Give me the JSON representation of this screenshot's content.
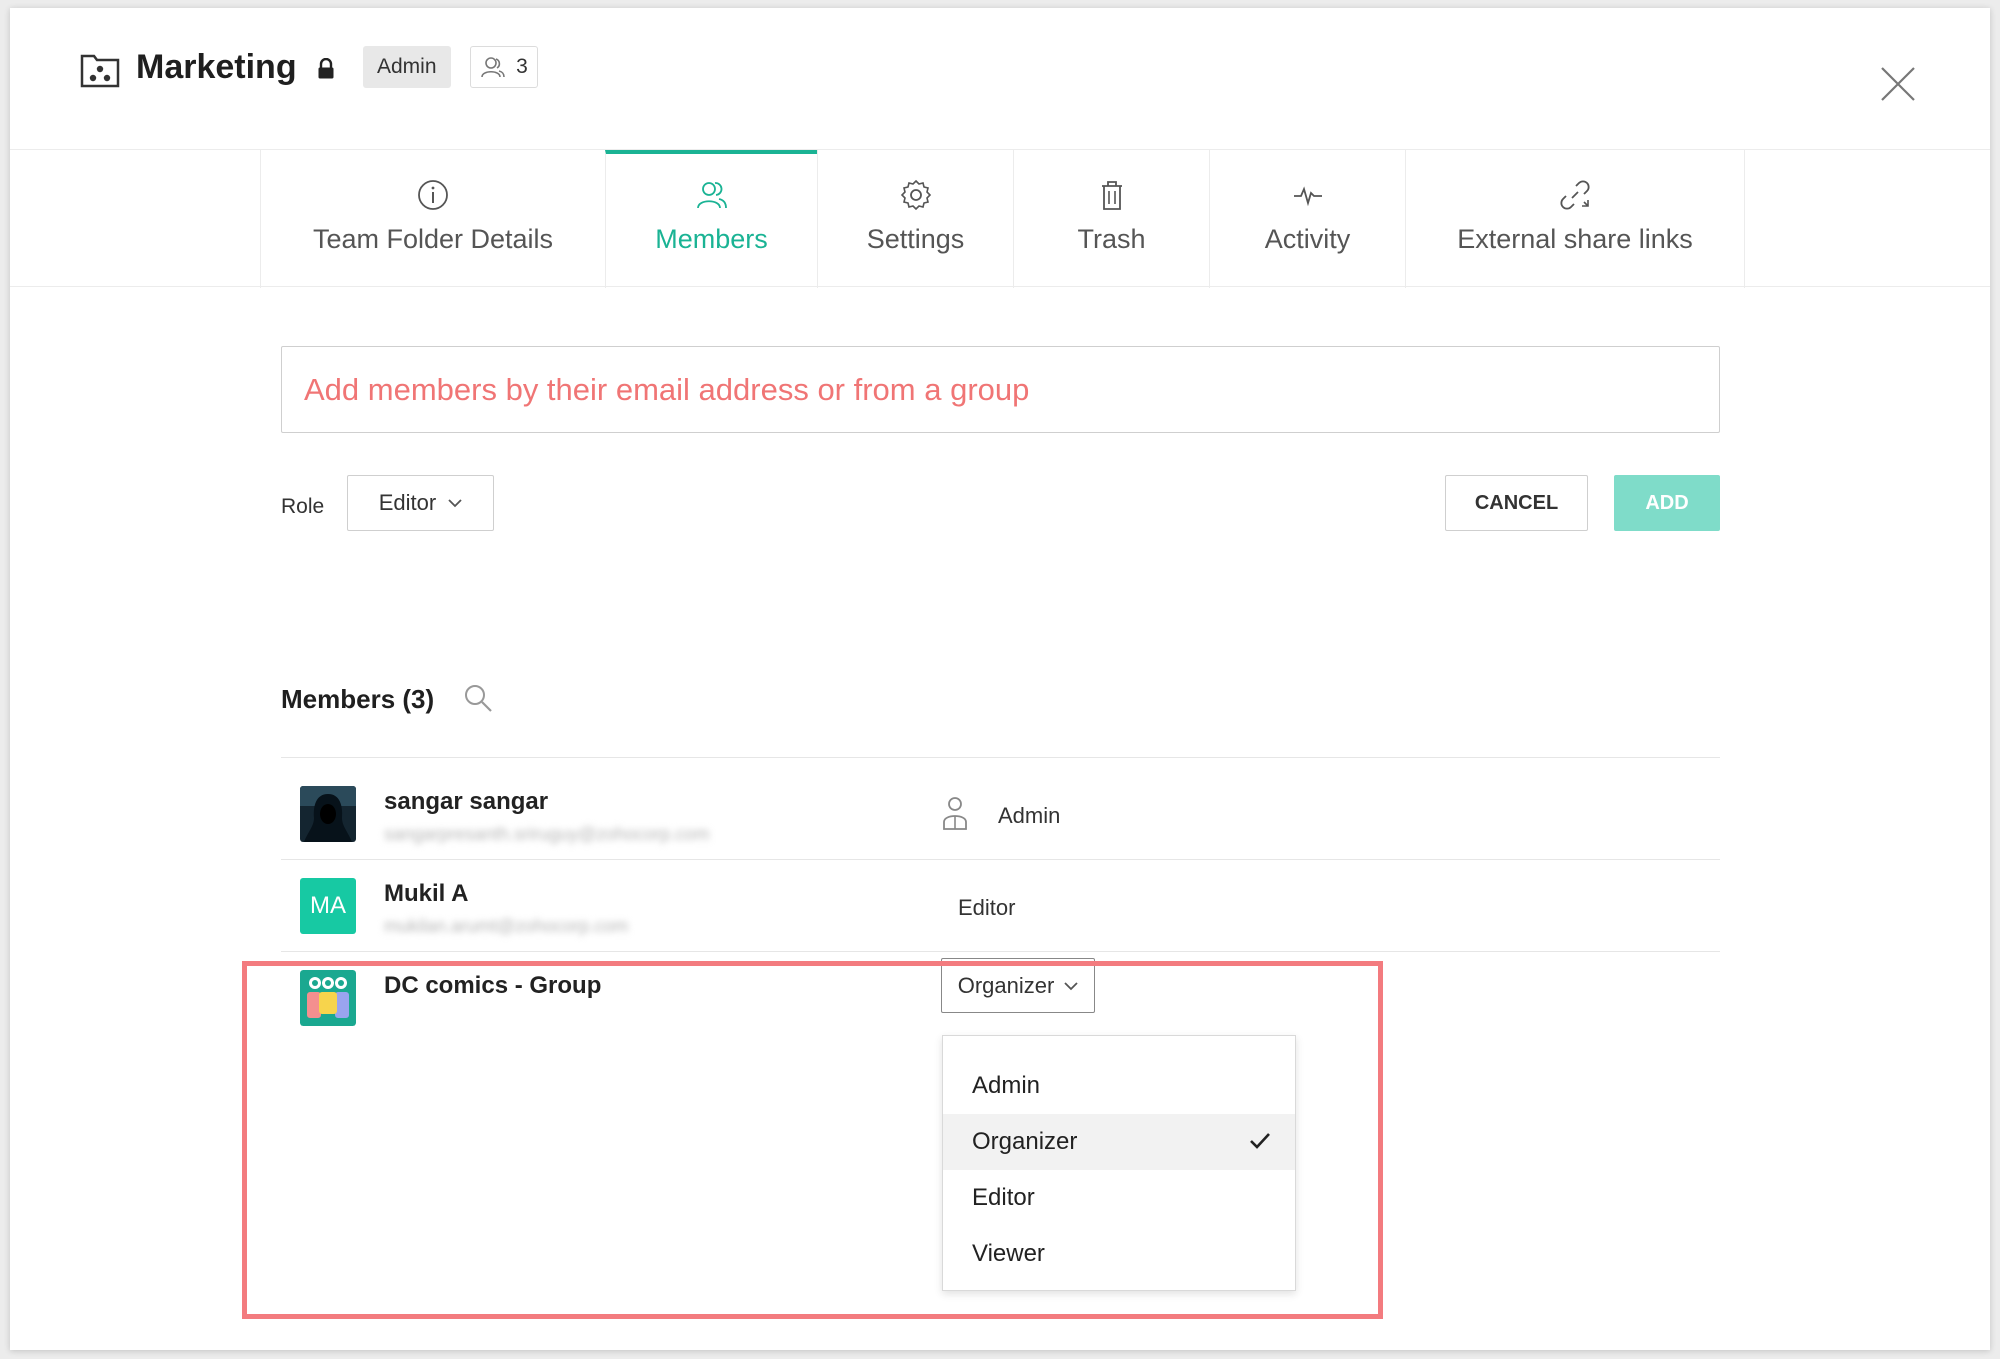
{
  "header": {
    "title": "Marketing",
    "role_badge": "Admin",
    "member_count": "3"
  },
  "tabs": [
    {
      "label": "Team Folder Details",
      "icon": "info-icon"
    },
    {
      "label": "Members",
      "icon": "members-icon",
      "active": true
    },
    {
      "label": "Settings",
      "icon": "gear-icon"
    },
    {
      "label": "Trash",
      "icon": "trash-icon"
    },
    {
      "label": "Activity",
      "icon": "activity-icon"
    },
    {
      "label": "External share links",
      "icon": "link-icon"
    }
  ],
  "add_members": {
    "placeholder": "Add members by their email address or from a group",
    "role_label": "Role",
    "role_value": "Editor",
    "cancel_label": "CANCEL",
    "add_label": "ADD"
  },
  "members": {
    "heading": "Members (3)",
    "list": [
      {
        "name": "sangar sangar",
        "email": "sangarpresanth.sriruguy@zohocorp.com",
        "role": "Admin",
        "avatar": "photo"
      },
      {
        "name": "Mukil A",
        "email": "mukilan.arumt@zohocorp.com",
        "role": "Editor",
        "avatar": "initials",
        "initials": "MA"
      },
      {
        "name": "DC comics - Group",
        "email": "",
        "role": "Organizer",
        "avatar": "group-icon"
      }
    ]
  },
  "role_menu": {
    "options": [
      "Admin",
      "Organizer",
      "Editor",
      "Viewer"
    ],
    "selected": "Organizer"
  },
  "colors": {
    "accent": "#1ab394",
    "add_button": "#7fdcc9",
    "placeholder": "#f07575",
    "highlight": "#f37b7f",
    "initials_avatar": "#17c9a3"
  }
}
